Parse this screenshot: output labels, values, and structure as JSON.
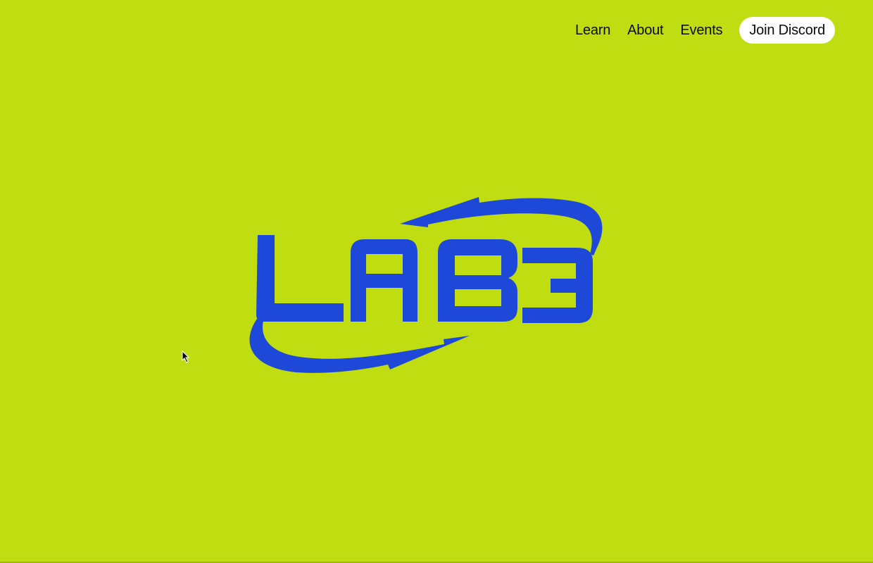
{
  "colors": {
    "background": "#BFDD10",
    "brand_blue": "#1E49D8",
    "text": "#0B0B0B",
    "cta_background": "#FFFFFF"
  },
  "nav": {
    "items": [
      {
        "label": "Learn"
      },
      {
        "label": "About"
      },
      {
        "label": "Events"
      }
    ],
    "cta_label": "Join Discord"
  },
  "hero": {
    "logo_text": "LAB3"
  },
  "icons": {
    "cursor": "mouse-pointer-icon"
  }
}
